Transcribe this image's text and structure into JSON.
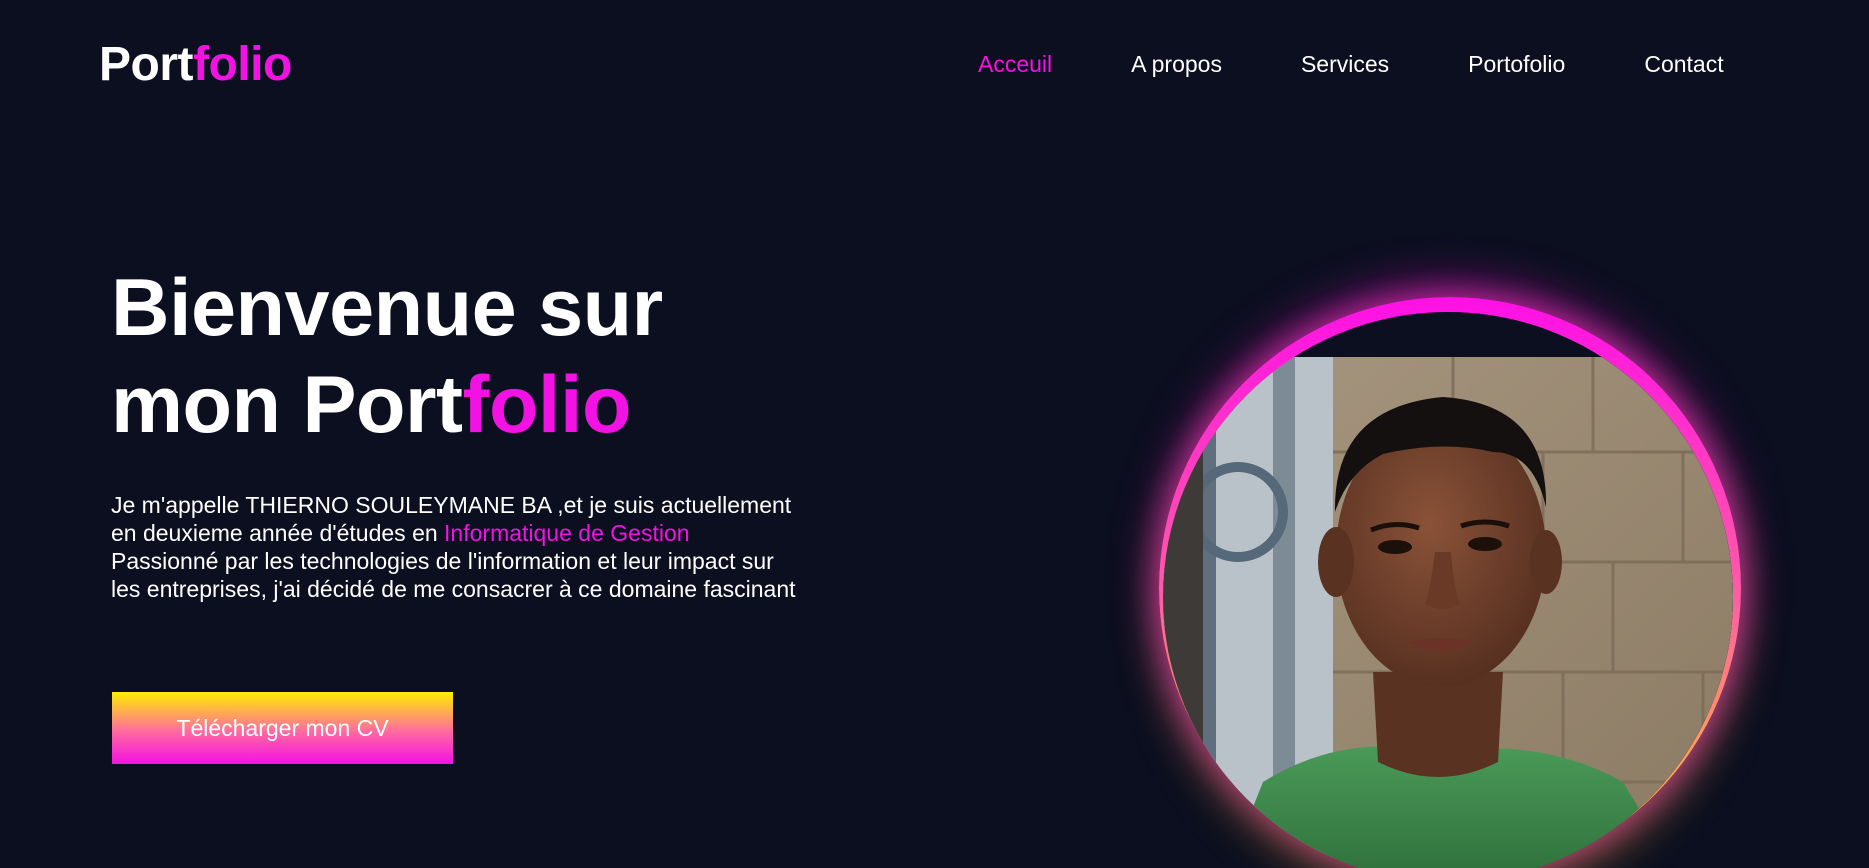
{
  "header": {
    "logo": {
      "part1": "Port",
      "part2": "folio"
    },
    "nav": [
      {
        "label": "Acceuil",
        "active": true
      },
      {
        "label": "A propos",
        "active": false
      },
      {
        "label": "Services",
        "active": false
      },
      {
        "label": "Portofolio",
        "active": false
      },
      {
        "label": "Contact",
        "active": false
      }
    ]
  },
  "hero": {
    "title_line1": "Bienvenue sur",
    "title_line2_prefix": "mon Port",
    "title_line2_accent": "folio",
    "desc_part1": "Je m'appelle THIERNO SOULEYMANE BA ,et je suis actuellement en deuxieme année d'études en ",
    "desc_accent": "Informatique de Gestion",
    "desc_part2": " Passionné par les technologies de l'information et leur impact sur les entreprises, j'ai décidé de me consacrer à ce domaine fascinant",
    "cv_button": "Télécharger mon CV"
  },
  "colors": {
    "background": "#0c0f20",
    "accent": "#f312e4",
    "gradient_top": "#ffef00",
    "gradient_bottom": "#f312e4"
  }
}
